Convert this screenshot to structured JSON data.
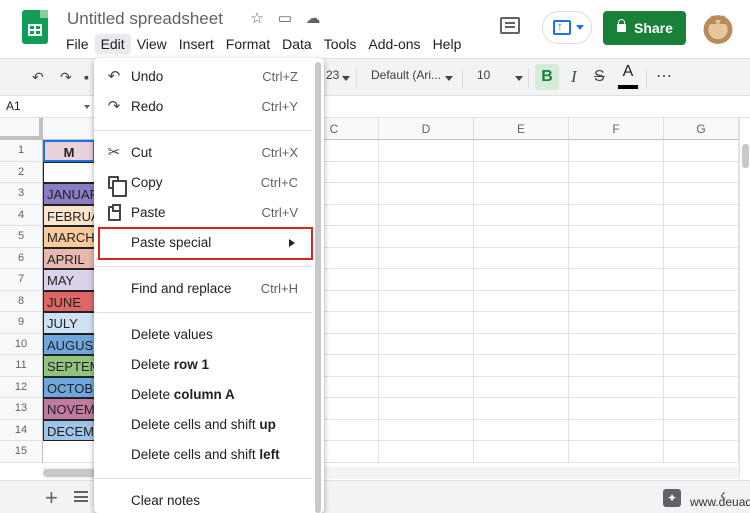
{
  "app": {
    "title": "Untitled spreadsheet",
    "menus": [
      "File",
      "Edit",
      "View",
      "Insert",
      "Format",
      "Data",
      "Tools",
      "Add-ons",
      "Help"
    ],
    "active_menu": "Edit",
    "share_label": "Share",
    "icons": [
      "sheets-logo-icon",
      "star-icon",
      "move-to-folder-icon",
      "cloud-saved-icon",
      "comment-icon",
      "present-icon",
      "lock-icon",
      "avatar"
    ]
  },
  "toolbar": {
    "number_format": "23",
    "font": "Default (Ari...",
    "font_size": "10",
    "bold": "B",
    "italic": "I",
    "strike": "S",
    "text_color": "A",
    "more": "⋯"
  },
  "formula_bar": {
    "cell_ref": "A1"
  },
  "grid": {
    "columns": [
      "C",
      "D",
      "E",
      "F",
      "G"
    ],
    "rows": [
      "1",
      "2",
      "3",
      "4",
      "5",
      "6",
      "7",
      "8",
      "9",
      "10",
      "11",
      "12",
      "13",
      "14",
      "15"
    ],
    "col_a_cells": [
      {
        "text": "M",
        "color": "#ead1dc"
      },
      {
        "text": "",
        "color": "#ffffff"
      },
      {
        "text": "JANUAR",
        "color": "#8e7cc3"
      },
      {
        "text": "FEBRUA",
        "color": "#fce5cd"
      },
      {
        "text": "MARCH",
        "color": "#f9cb9c"
      },
      {
        "text": "APRIL",
        "color": "#e6b8af"
      },
      {
        "text": "MAY",
        "color": "#d9d2e9"
      },
      {
        "text": "JUNE",
        "color": "#e06666"
      },
      {
        "text": "JULY",
        "color": "#cfe2f3"
      },
      {
        "text": "AUGUST",
        "color": "#6fa8dc"
      },
      {
        "text": "SEPTEM",
        "color": "#93c47d"
      },
      {
        "text": "OCTOBE",
        "color": "#6fa8dc"
      },
      {
        "text": "NOVEM",
        "color": "#c27ba0"
      },
      {
        "text": "DECEM",
        "color": "#9fc5e8"
      },
      {
        "text": "",
        "color": "#ffffff"
      }
    ]
  },
  "edit_menu": {
    "items": [
      {
        "label": "Undo",
        "shortcut": "Ctrl+Z",
        "icon": "undo-icon"
      },
      {
        "label": "Redo",
        "shortcut": "Ctrl+Y",
        "icon": "redo-icon"
      },
      {
        "label": "Cut",
        "shortcut": "Ctrl+X",
        "icon": "scissors-icon"
      },
      {
        "label": "Copy",
        "shortcut": "Ctrl+C",
        "icon": "copy-icon"
      },
      {
        "label": "Paste",
        "shortcut": "Ctrl+V",
        "icon": "paste-icon"
      },
      {
        "label": "Paste special",
        "shortcut": "",
        "icon": "submenu-arrow-icon"
      },
      {
        "label": "Find and replace",
        "shortcut": "Ctrl+H"
      },
      {
        "label": "Delete values",
        "shortcut": ""
      },
      {
        "label": "Delete ",
        "bold": "row 1"
      },
      {
        "label": "Delete ",
        "bold": "column A"
      },
      {
        "label": "Delete cells and shift ",
        "bold": "up"
      },
      {
        "label": "Delete cells and shift ",
        "bold": "left"
      },
      {
        "label": "Clear notes",
        "shortcut": ""
      }
    ],
    "highlighted": "Paste special"
  },
  "watermark": "www.deuaq.com",
  "colors": {
    "share": "#188038",
    "highlight_box": "#d9231c",
    "toolbar_bg": "#f1f3f4"
  }
}
